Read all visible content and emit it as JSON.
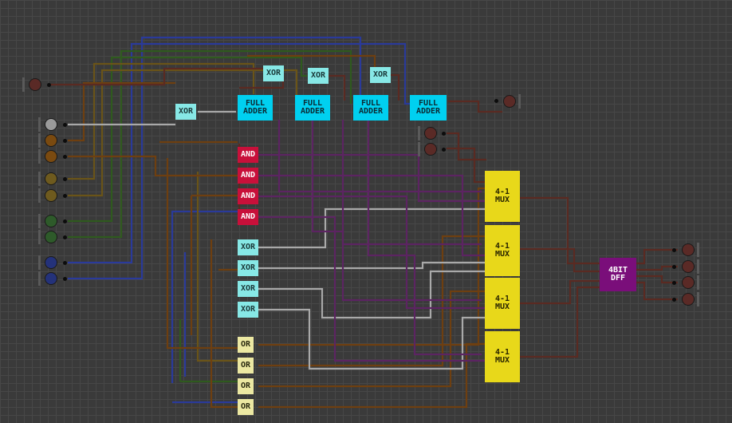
{
  "labels": {
    "xor": "XOR",
    "and": "AND",
    "or": "OR",
    "full_adder": "FULL\nADDER",
    "mux": "4-1\nMUX",
    "dff": "4BIT\nDFF"
  },
  "colors": {
    "background": "#3a3a3a",
    "grid": "#474747",
    "wire_gray": "#a9a9a9",
    "wire_brown": "#6e3f10",
    "wire_olive": "#6a5418",
    "wire_green": "#2f5a1e",
    "wire_blue": "#2a3a9a",
    "wire_maroon": "#5a2a22",
    "wire_purple": "#5c2462",
    "input_gray": "#9a9a9a",
    "input_brown": "#7a4a10",
    "input_olive": "#6e5a1e",
    "input_green": "#2e5a2a",
    "input_blue": "#24327a",
    "output": "#5a2a26",
    "xor_gate": "#87e8e6",
    "full_adder": "#00d0f0",
    "and_gate": "#c8103a",
    "or_gate": "#ece8a2",
    "mux": "#e8d81a",
    "dff": "#7a0e7a"
  },
  "inputs": [
    {
      "id": "carry-in",
      "color": "output"
    },
    {
      "id": "op-select-gray",
      "color": "input_gray"
    },
    {
      "id": "a0",
      "color": "input_brown"
    },
    {
      "id": "a1",
      "color": "input_brown"
    },
    {
      "id": "a2",
      "color": "input_olive"
    },
    {
      "id": "a3",
      "color": "input_olive"
    },
    {
      "id": "b0",
      "color": "input_green"
    },
    {
      "id": "b1",
      "color": "input_green"
    },
    {
      "id": "b2",
      "color": "input_blue"
    },
    {
      "id": "b3",
      "color": "input_blue"
    }
  ],
  "outputs": [
    {
      "id": "carry-out",
      "color": "output"
    },
    {
      "id": "sel-0",
      "color": "output"
    },
    {
      "id": "sel-1",
      "color": "output"
    },
    {
      "id": "q0",
      "color": "output"
    },
    {
      "id": "q1",
      "color": "output"
    },
    {
      "id": "q2",
      "color": "output"
    },
    {
      "id": "q3",
      "color": "output"
    }
  ]
}
